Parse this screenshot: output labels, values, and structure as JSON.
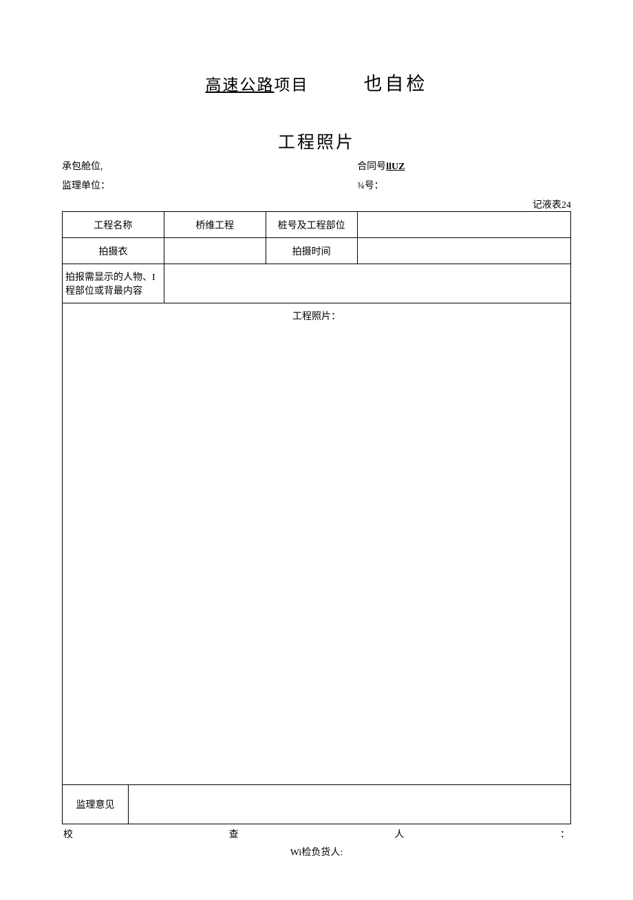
{
  "title": {
    "left_underlined": "高速公路",
    "left_plain": "项目",
    "right": "也自检"
  },
  "subtitle": "工程照片",
  "meta": {
    "row1_left": "承包舱位,",
    "row1_right_label": "合同号",
    "row1_right_value": "llUZ",
    "row2_left": "监理单位：",
    "row2_right": "¾号："
  },
  "table_number": "记液表24",
  "headers": {
    "r1c1": "工程名称",
    "r1c2": "桥维工程",
    "r1c3": "桩号及工程部位",
    "r1c4": "",
    "r2c1": "拍摄衣",
    "r2c2": "",
    "r2c3": "拍摄时间",
    "r2c4": "",
    "r3c1": "拍报需显示的人物、I程部位或背最内容",
    "r3c2": "",
    "photo_label": "工程照片：",
    "opinion_label": "监理意见",
    "opinion_value": ""
  },
  "footer": {
    "c1": "校",
    "c2": "查",
    "c3": "人",
    "c4": "：",
    "person": "Wi检负货人:"
  }
}
